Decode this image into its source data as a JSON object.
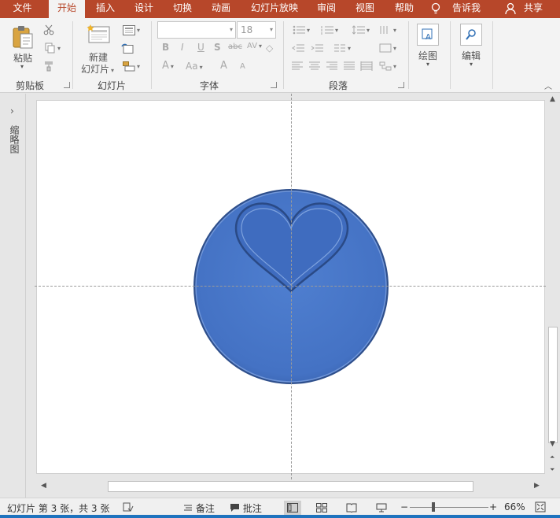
{
  "tabs": [
    "文件",
    "开始",
    "插入",
    "设计",
    "切换",
    "动画",
    "幻灯片放映",
    "审阅",
    "视图",
    "帮助"
  ],
  "active_tab": "开始",
  "tell_me": "告诉我",
  "share": "共享",
  "clipboard": {
    "paste_label": "粘贴",
    "group_label": "剪贴板"
  },
  "slides": {
    "new_slide_line1": "新建",
    "new_slide_line2": "幻灯片",
    "group_label": "幻灯片"
  },
  "font": {
    "font_name": "",
    "font_size": "18",
    "group_label": "字体",
    "bold": "B",
    "italic": "I",
    "underline": "U",
    "shadow": "S",
    "strike": "abc",
    "spacing": "AV",
    "font_color": "A",
    "change_case": "Aa",
    "grow": "A",
    "shrink": "A"
  },
  "paragraph": {
    "group_label": "段落"
  },
  "drawing": {
    "label": "绘图"
  },
  "editing": {
    "label": "编辑"
  },
  "left_panel": {
    "label": "缩略图"
  },
  "status": {
    "slide_info": "幻灯片 第 3 张，共 3 张",
    "notes": "备注",
    "comments": "批注",
    "zoom": "66%"
  },
  "colors": {
    "accent": "#b7472a",
    "shape_blue": "#4472c4",
    "shape_border": "#2f528f"
  },
  "icons": [
    "paste-icon",
    "cut-icon",
    "copy-icon",
    "format-painter-icon",
    "new-slide-icon",
    "layout-icon",
    "reset-icon",
    "section-icon",
    "drawing-icon",
    "search-icon",
    "lightbulb-icon",
    "person-icon",
    "accessibility-icon",
    "notes-icon",
    "comments-icon",
    "normal-view-icon",
    "slide-sorter-icon",
    "reading-view-icon",
    "slideshow-icon",
    "fit-icon"
  ]
}
